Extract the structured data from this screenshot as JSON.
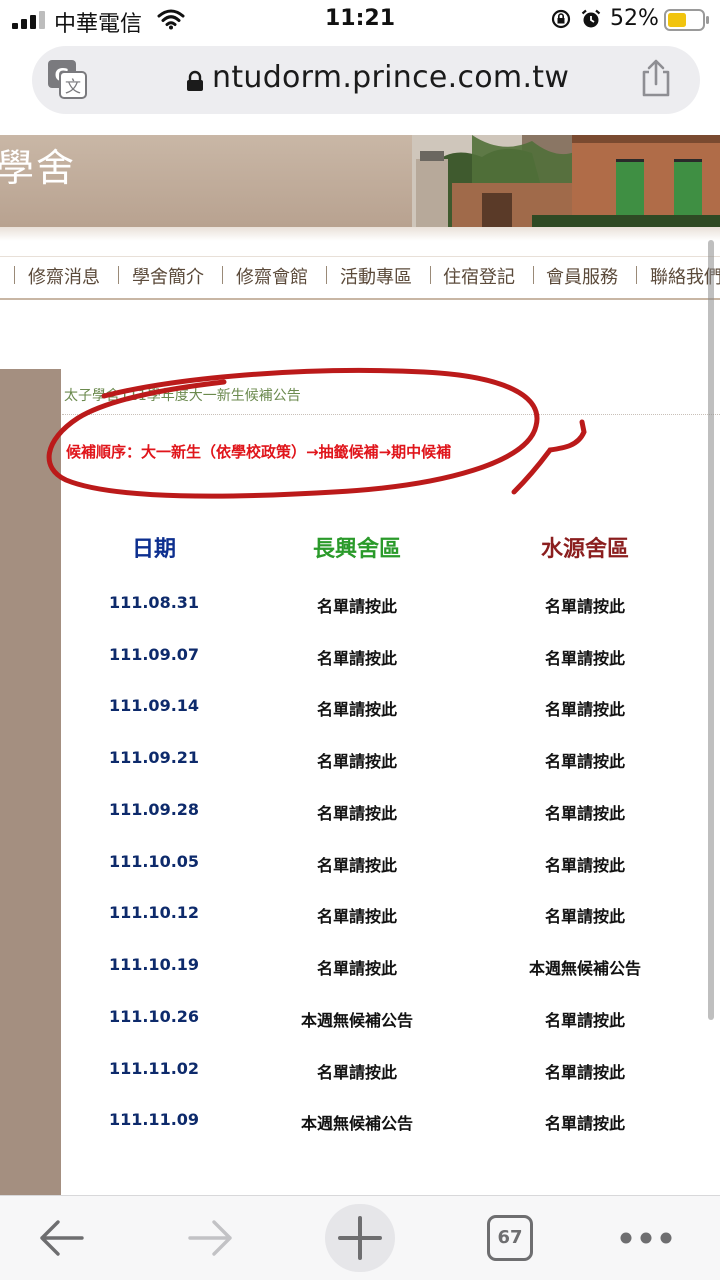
{
  "status_bar": {
    "carrier": "中華電信",
    "time": "11:21",
    "battery": "52%"
  },
  "browser": {
    "url": "ntudorm.prince.com.tw",
    "tab_count": "67",
    "accent_color": "#f1c40f"
  },
  "site": {
    "banner_title": "學舍",
    "nav": [
      "修齋消息",
      "學舍簡介",
      "修齋會館",
      "活動專區",
      "住宿登記",
      "會員服務",
      "聯絡我們"
    ]
  },
  "announcement": {
    "title": "太子學舍111學年度大一新生候補公告",
    "order": "候補順序：大一新生（依學校政策）→抽籤候補→期中候補",
    "highlight_color": "#c0201e"
  },
  "table": {
    "headers": [
      "日期",
      "長興舍區",
      "水源舍區"
    ],
    "rows": [
      [
        "111.08.31",
        "名單請按此",
        "名單請按此"
      ],
      [
        "111.09.07",
        "名單請按此",
        "名單請按此"
      ],
      [
        "111.09.14",
        "名單請按此",
        "名單請按此"
      ],
      [
        "111.09.21",
        "名單請按此",
        "名單請按此"
      ],
      [
        "111.09.28",
        "名單請按此",
        "名單請按此"
      ],
      [
        "111.10.05",
        "名單請按此",
        "名單請按此"
      ],
      [
        "111.10.12",
        "名單請按此",
        "名單請按此"
      ],
      [
        "111.10.19",
        "名單請按此",
        "本週無候補公告"
      ],
      [
        "111.10.26",
        "本週無候補公告",
        "名單請按此"
      ],
      [
        "111.11.02",
        "名單請按此",
        "名單請按此"
      ],
      [
        "111.11.09",
        "本週無候補公告",
        "名單請按此"
      ]
    ]
  },
  "icons": {
    "status": [
      "signal-icon",
      "wifi-icon",
      "rotation-lock-icon",
      "alarm-icon",
      "battery-icon"
    ],
    "address_bar": [
      "translate-icon",
      "padlock-icon",
      "share-icon"
    ],
    "toolbar": [
      "back-arrow-icon",
      "forward-arrow-icon",
      "plus-icon",
      "tabs-icon",
      "more-icon"
    ]
  }
}
